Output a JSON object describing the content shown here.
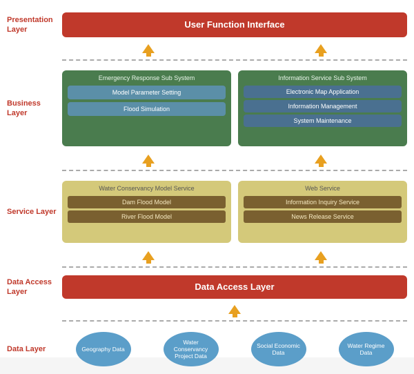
{
  "layers": {
    "presentation": {
      "label": "Presentation\nLayer",
      "box": "User Function Interface"
    },
    "business": {
      "label": "Business Layer",
      "subsystems": [
        {
          "title": "Emergency Response Sub System",
          "modules": [
            "Model Parameter Setting",
            "Flood Simulation"
          ]
        },
        {
          "title": "Information Service Sub System",
          "modules": [
            "Electronic Map Application",
            "Information Management",
            "System Maintenance"
          ]
        }
      ]
    },
    "service": {
      "label": "Service Layer",
      "services": [
        {
          "title": "Water Conservancy Model Service",
          "modules": [
            "Dam Flood Model",
            "River Flood Model"
          ]
        },
        {
          "title": "Web Service",
          "modules": [
            "Information Inquiry Service",
            "News Release Service"
          ]
        }
      ]
    },
    "dataAccess": {
      "label": "Data Access\nLayer",
      "box": "Data Access Layer"
    },
    "data": {
      "label": "Data Layer",
      "items": [
        "Geography Data",
        "Water Conservancy\nProject Data",
        "Social Economic\nData",
        "Water Regime Data"
      ]
    }
  },
  "arrows": {
    "color": "#e8a020"
  }
}
